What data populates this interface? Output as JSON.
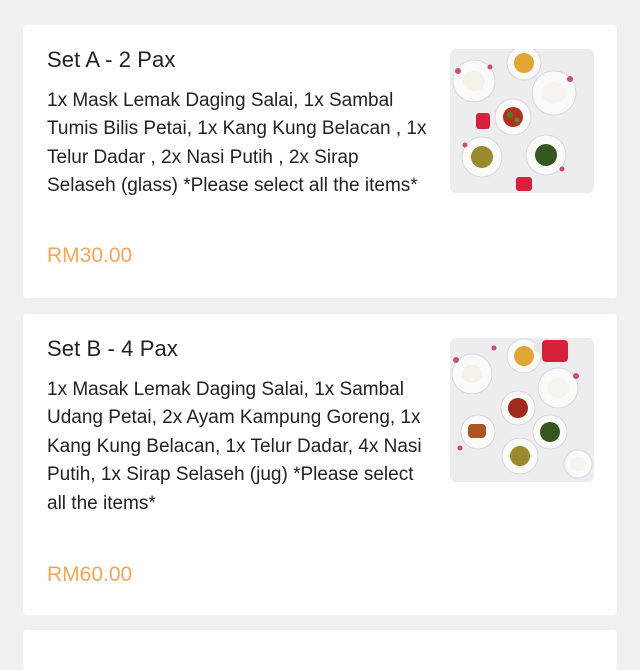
{
  "menu_items": [
    {
      "title": "Set A - 2 Pax",
      "description": "1x Mask Lemak Daging Salai, 1x Sambal Tumis Bilis Petai, 1x Kang Kung Belacan , 1x Telur Dadar , 2x Nasi Putih , 2x Sirap Selaseh (glass) *Please select all the items*",
      "price": "RM30.00",
      "image_icon": "food-photo-icon"
    },
    {
      "title": "Set B - 4 Pax",
      "description": "1x Masak Lemak Daging Salai, 1x Sambal Udang Petai, 2x Ayam Kampung Goreng, 1x Kang Kung Belacan, 1x Telur Dadar, 4x Nasi Putih, 1x Sirap Selaseh (jug) *Please select all the items*",
      "price": "RM60.00",
      "image_icon": "food-photo-icon"
    }
  ],
  "colors": {
    "background": "#f0f0f3",
    "card": "#ffffff",
    "text": "#222222",
    "price": "#f2a65a"
  }
}
